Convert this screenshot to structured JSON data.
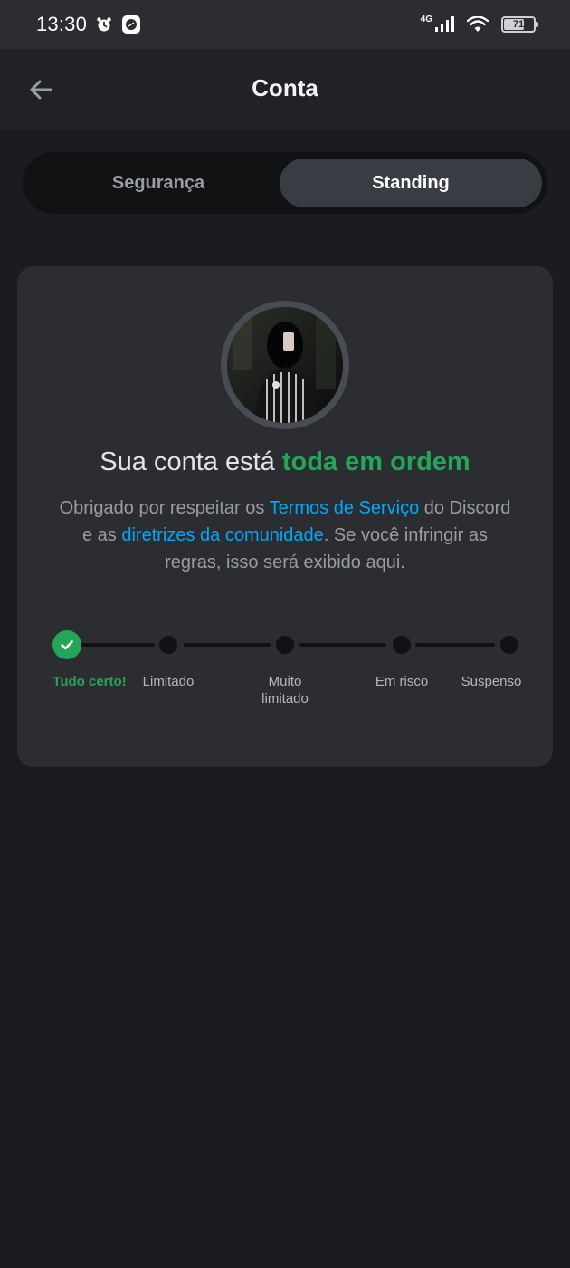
{
  "status_bar": {
    "time": "13:30",
    "network": "4G",
    "battery": "71",
    "battery_level": 0.71,
    "icons": [
      "alarm-icon",
      "app-notification-icon",
      "signal-icon",
      "wifi-icon",
      "battery-icon"
    ]
  },
  "header": {
    "title": "Conta",
    "back_icon": "arrow-left-icon"
  },
  "tabs": [
    {
      "label": "Segurança",
      "active": false
    },
    {
      "label": "Standing",
      "active": true
    }
  ],
  "standing": {
    "headline_prefix": "Sua conta está ",
    "headline_status": "toda em ordem",
    "desc_part1": "Obrigado por respeitar os ",
    "link_terms": "Termos de Serviço",
    "desc_part2": " do Discord e as ",
    "link_guidelines": "diretrizes da comunidade",
    "desc_part3": ". Se você infringir as regras, isso será exibido aqui.",
    "steps": [
      {
        "label": "Tudo certo!",
        "current": true
      },
      {
        "label": "Limitado",
        "current": false
      },
      {
        "label": "Muito",
        "label2": "limitado",
        "current": false
      },
      {
        "label": "Em risco",
        "current": false
      },
      {
        "label": "Suspenso",
        "current": false
      }
    ]
  },
  "colors": {
    "accent_green": "#23a55a",
    "link_blue": "#00a8fc",
    "background": "#1b1c21",
    "card": "#2b2d31"
  }
}
